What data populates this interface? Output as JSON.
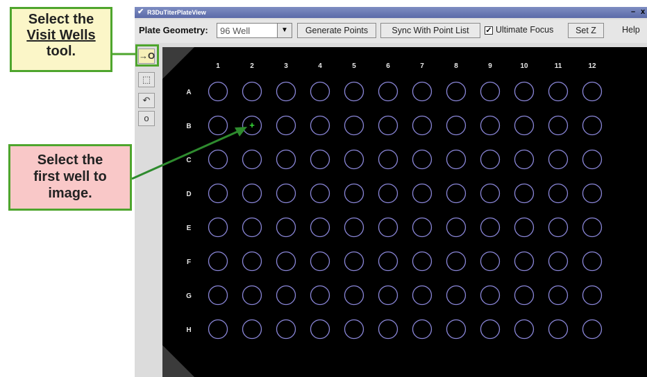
{
  "window": {
    "title": "R3DuTiterPlateView",
    "minimize_label": "–",
    "close_label": "x"
  },
  "toolbar": {
    "plate_geometry_label": "Plate Geometry:",
    "plate_geometry_value": "96 Well",
    "generate_points_label": "Generate Points",
    "sync_label": "Sync With Point List",
    "ultimate_focus_label": "Ultimate Focus",
    "ultimate_focus_checked": true,
    "set_z_label": "Set Z",
    "help_label": "Help"
  },
  "tools": [
    {
      "name": "visit-wells-tool",
      "glyph": "→O",
      "active": true
    },
    {
      "name": "select-region-tool",
      "glyph": "⬚",
      "active": false
    },
    {
      "name": "undo-tool",
      "glyph": "↶",
      "active": false
    },
    {
      "name": "single-point-tool",
      "glyph": "o",
      "active": false
    }
  ],
  "plate": {
    "columns": [
      "1",
      "2",
      "3",
      "4",
      "5",
      "6",
      "7",
      "8",
      "9",
      "10",
      "11",
      "12"
    ],
    "rows": [
      "A",
      "B",
      "C",
      "D",
      "E",
      "F",
      "G",
      "H"
    ],
    "selected_well": {
      "row": "B",
      "column": "2",
      "marker": "+"
    },
    "well_color": "#8a86d8",
    "marker_color": "#38e038"
  },
  "callouts": {
    "top_line1": "Select the",
    "top_line2": "Visit Wells",
    "top_line3": "tool.",
    "mid_line1": "Select the",
    "mid_line2": "first well to",
    "mid_line3": "image."
  },
  "colors": {
    "accent_green": "#4ea52d",
    "title_bar": "#5b6aa8"
  }
}
